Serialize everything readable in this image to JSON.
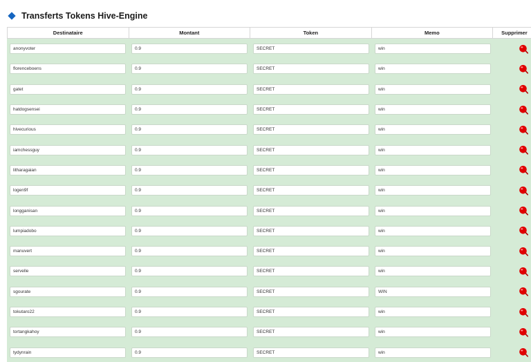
{
  "title": "Transferts Tokens Hive-Engine",
  "columns": {
    "recipient": "Destinataire",
    "amount": "Montant",
    "token": "Token",
    "memo": "Memo",
    "delete": "Supprimer"
  },
  "rows": [
    {
      "recipient": "anonyvoter",
      "amount": "0.9",
      "token": "SECRET",
      "memo": "win"
    },
    {
      "recipient": "florenceboens",
      "amount": "0.9",
      "token": "SECRET",
      "memo": "win"
    },
    {
      "recipient": "gatet",
      "amount": "0.9",
      "token": "SECRET",
      "memo": "win"
    },
    {
      "recipient": "hatdogsensei",
      "amount": "0.9",
      "token": "SECRET",
      "memo": "win"
    },
    {
      "recipient": "hivecurious",
      "amount": "0.9",
      "token": "SECRET",
      "memo": "win"
    },
    {
      "recipient": "iamchessguy",
      "amount": "0.9",
      "token": "SECRET",
      "memo": "win"
    },
    {
      "recipient": "litharagaian",
      "amount": "0.9",
      "token": "SECRET",
      "memo": "win"
    },
    {
      "recipient": "logen9f",
      "amount": "0.9",
      "token": "SECRET",
      "memo": "win"
    },
    {
      "recipient": "longganisan",
      "amount": "0.9",
      "token": "SECRET",
      "memo": "win"
    },
    {
      "recipient": "lumpiadobo",
      "amount": "0.9",
      "token": "SECRET",
      "memo": "win"
    },
    {
      "recipient": "manuvert",
      "amount": "0.9",
      "token": "SECRET",
      "memo": "win"
    },
    {
      "recipient": "servelle",
      "amount": "0.9",
      "token": "SECRET",
      "memo": "win"
    },
    {
      "recipient": "sgourate",
      "amount": "0.9",
      "token": "SECRET",
      "memo": "WIN"
    },
    {
      "recipient": "tokutaro22",
      "amount": "0.9",
      "token": "SECRET",
      "memo": "win"
    },
    {
      "recipient": "tortangkahoy",
      "amount": "0.9",
      "token": "SECRET",
      "memo": "win"
    },
    {
      "recipient": "tydynrain",
      "amount": "0.9",
      "token": "SECRET",
      "memo": "win"
    }
  ],
  "icons": {
    "title": "diamond-icon",
    "delete": "delete-icon"
  },
  "colors": {
    "row_bg": "#d5ebd6",
    "accent": "#1565c0",
    "delete": "#e00000"
  }
}
